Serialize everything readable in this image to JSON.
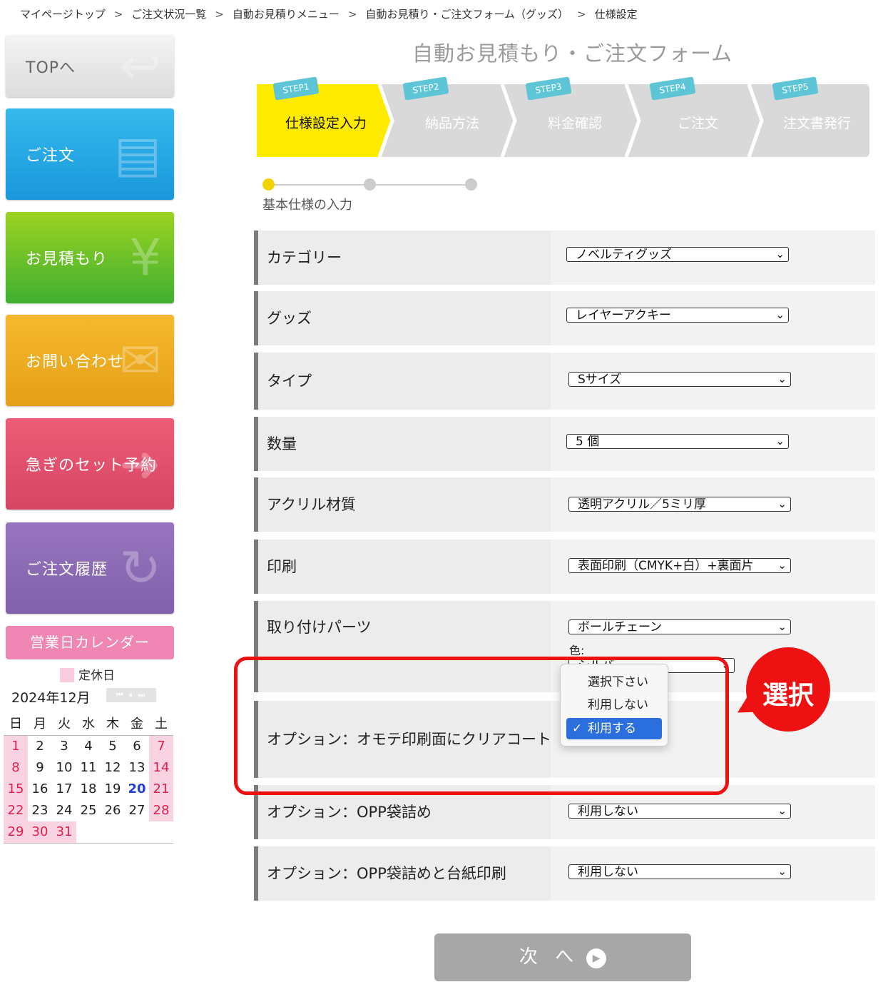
{
  "breadcrumb": [
    "マイページトップ",
    "ご注文状況一覧",
    "自動お見積りメニュー",
    "自動お見積り・ご注文フォーム（グッズ）",
    "仕様設定"
  ],
  "breadcrumb_sep": ">",
  "sidebar": {
    "top": "TOPへ",
    "order": "ご注文",
    "estimate": "お見積もり",
    "contact": "お問い合わせ",
    "rush": "急ぎのセット予約",
    "history": "ご注文履歴"
  },
  "calendar": {
    "title": "営業日カレンダー",
    "legend": "定休日",
    "month": "2024年12月",
    "weekdays": [
      "日",
      "月",
      "火",
      "水",
      "木",
      "金",
      "土"
    ],
    "weeks": [
      [
        "1",
        "2",
        "3",
        "4",
        "5",
        "6",
        "7"
      ],
      [
        "8",
        "9",
        "10",
        "11",
        "12",
        "13",
        "14"
      ],
      [
        "15",
        "16",
        "17",
        "18",
        "19",
        "20",
        "21"
      ],
      [
        "22",
        "23",
        "24",
        "25",
        "26",
        "27",
        "28"
      ],
      [
        "29",
        "30",
        "31",
        "",
        "",
        "",
        ""
      ]
    ],
    "holidays": [
      "1",
      "7",
      "8",
      "14",
      "15",
      "21",
      "22",
      "28",
      "29",
      "30",
      "31"
    ],
    "today": "20"
  },
  "form": {
    "title": "自動お見積もり・ご注文フォーム",
    "steps": [
      {
        "tag": "STEP1",
        "name": "仕様設定入力"
      },
      {
        "tag": "STEP2",
        "name": "納品方法"
      },
      {
        "tag": "STEP3",
        "name": "料金確認"
      },
      {
        "tag": "STEP4",
        "name": "ご注文"
      },
      {
        "tag": "STEP5",
        "name": "注文書発行"
      }
    ],
    "progress_label": "基本仕様の入力",
    "rows": [
      {
        "label": "カテゴリー",
        "value": "ノベルティグッズ"
      },
      {
        "label": "グッズ",
        "value": "レイヤーアクキー"
      },
      {
        "label": "タイプ",
        "value": "Sサイズ"
      },
      {
        "label": "数量",
        "value": "5 個"
      },
      {
        "label": "アクリル材質",
        "value": "透明アクリル／5ミリ厚"
      },
      {
        "label": "印刷",
        "value": "表面印刷（CMYK+白）+裏面片"
      },
      {
        "label": "取り付けパーツ",
        "value": "ボールチェーン"
      },
      {
        "label": "オプション：オモテ印刷面にクリアコート",
        "value": ""
      },
      {
        "label": "オプション：OPP袋詰め",
        "value": "利用しない"
      },
      {
        "label": "オプション：OPP袋詰めと台紙印刷",
        "value": "利用しない"
      }
    ],
    "color_label": "色:",
    "color_value": "シルバー",
    "dropdown_options": [
      "選択下さい",
      "利用しない",
      "利用する"
    ],
    "dropdown_selected": "利用する",
    "annotation": "選択",
    "next": "次 へ"
  }
}
